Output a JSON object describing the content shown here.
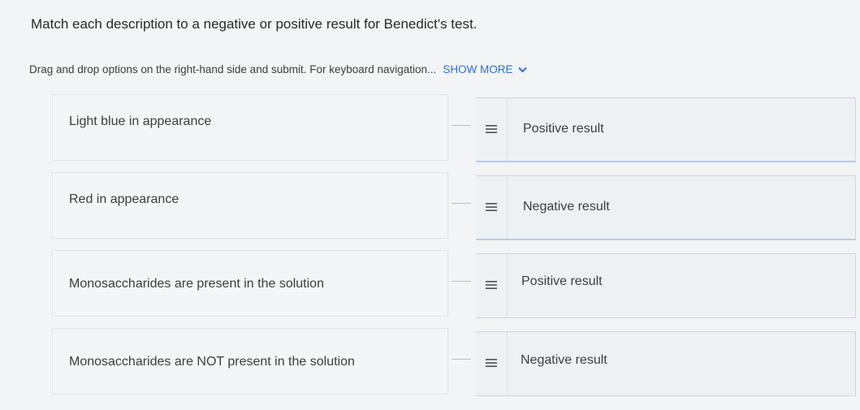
{
  "question": "Match each description to a negative or positive result for Benedict's test.",
  "instructions": {
    "text": "Drag and drop options on the right-hand side and submit. For keyboard navigation...",
    "show_more_label": "SHOW MORE",
    "show_more_icon": "chevron-down-icon"
  },
  "pairs": [
    {
      "prompt": "Light blue in appearance",
      "answer": "Positive result"
    },
    {
      "prompt": "Red in appearance",
      "answer": "Negative result"
    },
    {
      "prompt": "Monosaccharides are present in the solution",
      "answer": "Positive result"
    },
    {
      "prompt": "Monosaccharides are NOT present in the solution",
      "answer": "Negative result"
    }
  ],
  "handle_icon": "drag-handle-icon",
  "colors": {
    "link": "#2c6fd1",
    "background": "#f2f4f6",
    "answer_background": "#eef1f4",
    "border": "#cdd5df"
  }
}
